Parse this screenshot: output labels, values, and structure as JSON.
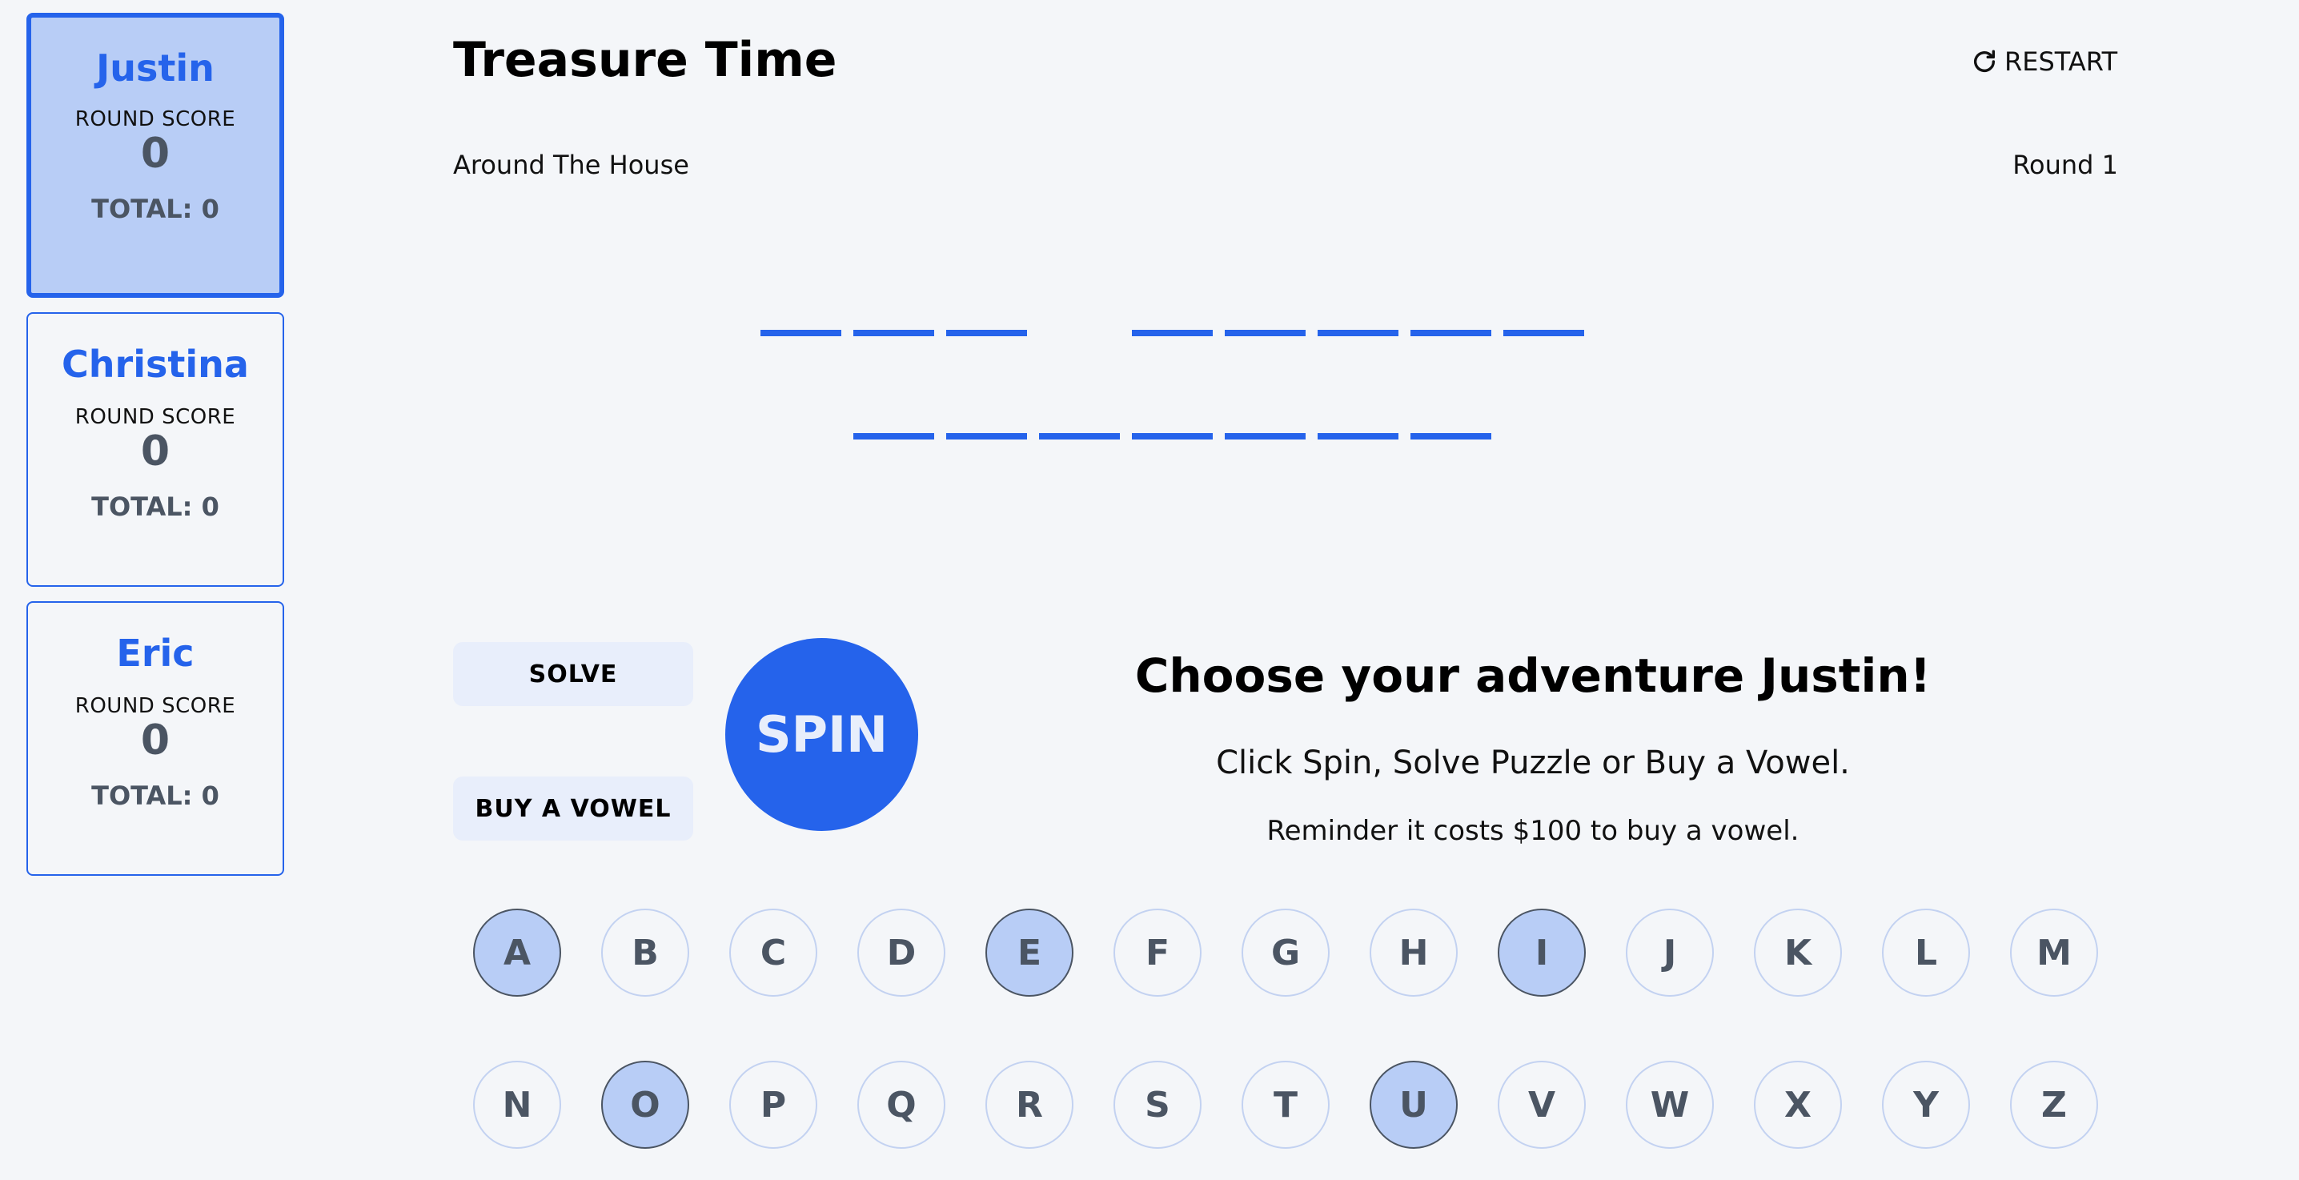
{
  "app": {
    "title": "Treasure Time",
    "restart_label": "RESTART"
  },
  "players": [
    {
      "name": "Justin",
      "round_label": "ROUND SCORE",
      "round_score": "0",
      "total": "TOTAL: 0",
      "active": true
    },
    {
      "name": "Christina",
      "round_label": "ROUND SCORE",
      "round_score": "0",
      "total": "TOTAL: 0",
      "active": false
    },
    {
      "name": "Eric",
      "round_label": "ROUND SCORE",
      "round_score": "0",
      "total": "TOTAL: 0",
      "active": false
    }
  ],
  "puzzle": {
    "category": "Around The House",
    "round": "Round 1",
    "lines": [
      [
        3,
        5
      ],
      [
        7
      ]
    ]
  },
  "actions": {
    "solve": "SOLVE",
    "buy_vowel": "BUY A VOWEL",
    "spin": "SPIN"
  },
  "message": {
    "heading": "Choose your adventure Justin!",
    "instruction": "Click Spin, Solve Puzzle or Buy a Vowel.",
    "reminder": "Reminder it costs $100 to buy a vowel."
  },
  "letters": {
    "row1": [
      "A",
      "B",
      "C",
      "D",
      "E",
      "F",
      "G",
      "H",
      "I",
      "J",
      "K",
      "L",
      "M"
    ],
    "row2": [
      "N",
      "O",
      "P",
      "Q",
      "R",
      "S",
      "T",
      "U",
      "V",
      "W",
      "X",
      "Y",
      "Z"
    ],
    "vowels": [
      "A",
      "E",
      "I",
      "O",
      "U"
    ]
  },
  "colors": {
    "accent": "#2563eb",
    "active_card": "#b8cdf6",
    "button_bg": "#e8eefb",
    "background": "#f4f6f9"
  }
}
